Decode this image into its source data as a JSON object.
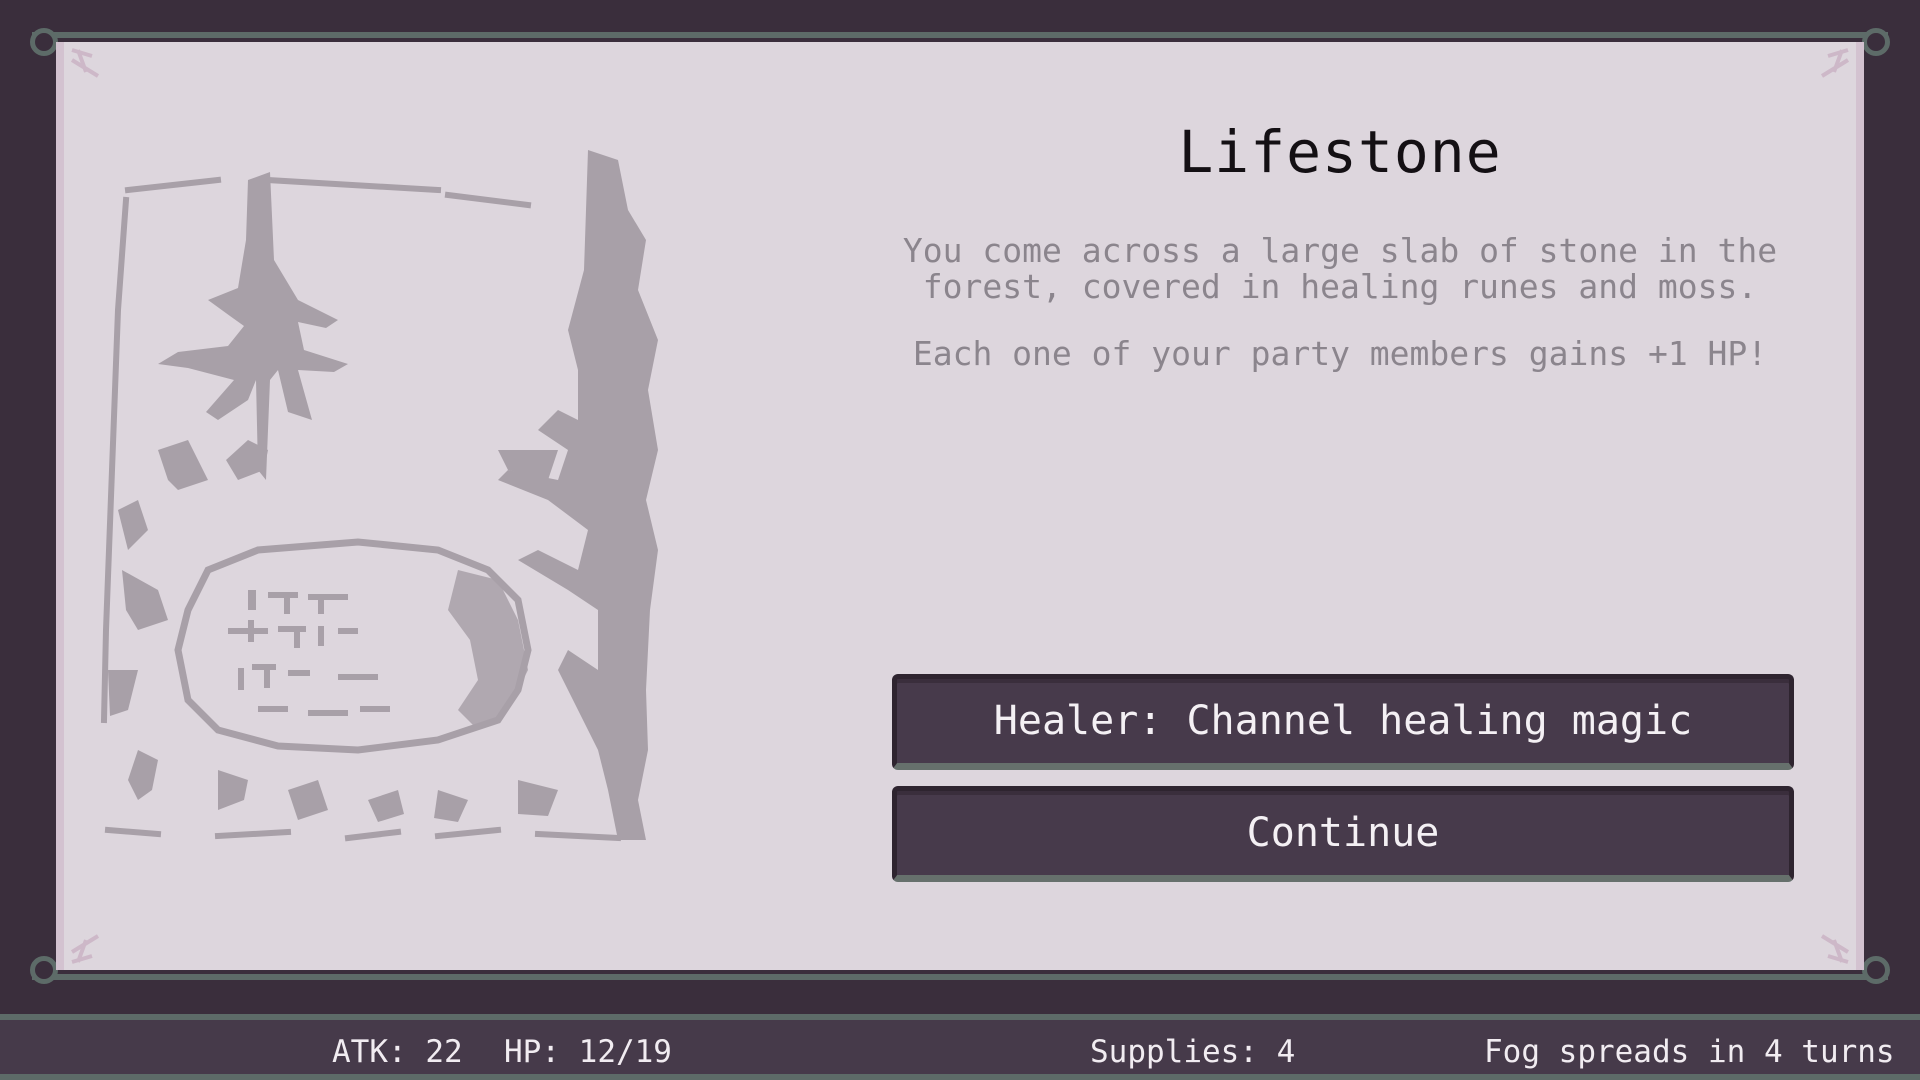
{
  "event": {
    "title": "Lifestone",
    "description": "You come across a large slab of stone in the forest, covered in healing runes and moss.",
    "effect": "Each one of your party members gains +1 HP!",
    "illustration": "forest-lifestone-illustration"
  },
  "choices": [
    {
      "label": "Healer: Channel healing magic"
    },
    {
      "label": "Continue"
    }
  ],
  "status": {
    "atk": "ATK: 22",
    "hp": "HP: 12/19",
    "supplies": "Supplies: 4",
    "fog": "Fog spreads in 4 turns"
  },
  "colors": {
    "background": "#3a2e3c",
    "card": "#ddd6dd",
    "frame": "#5d6b68",
    "button": "#473a4b",
    "illustration": "#a8a0a8",
    "title": "#141014",
    "description": "#8b858d"
  }
}
